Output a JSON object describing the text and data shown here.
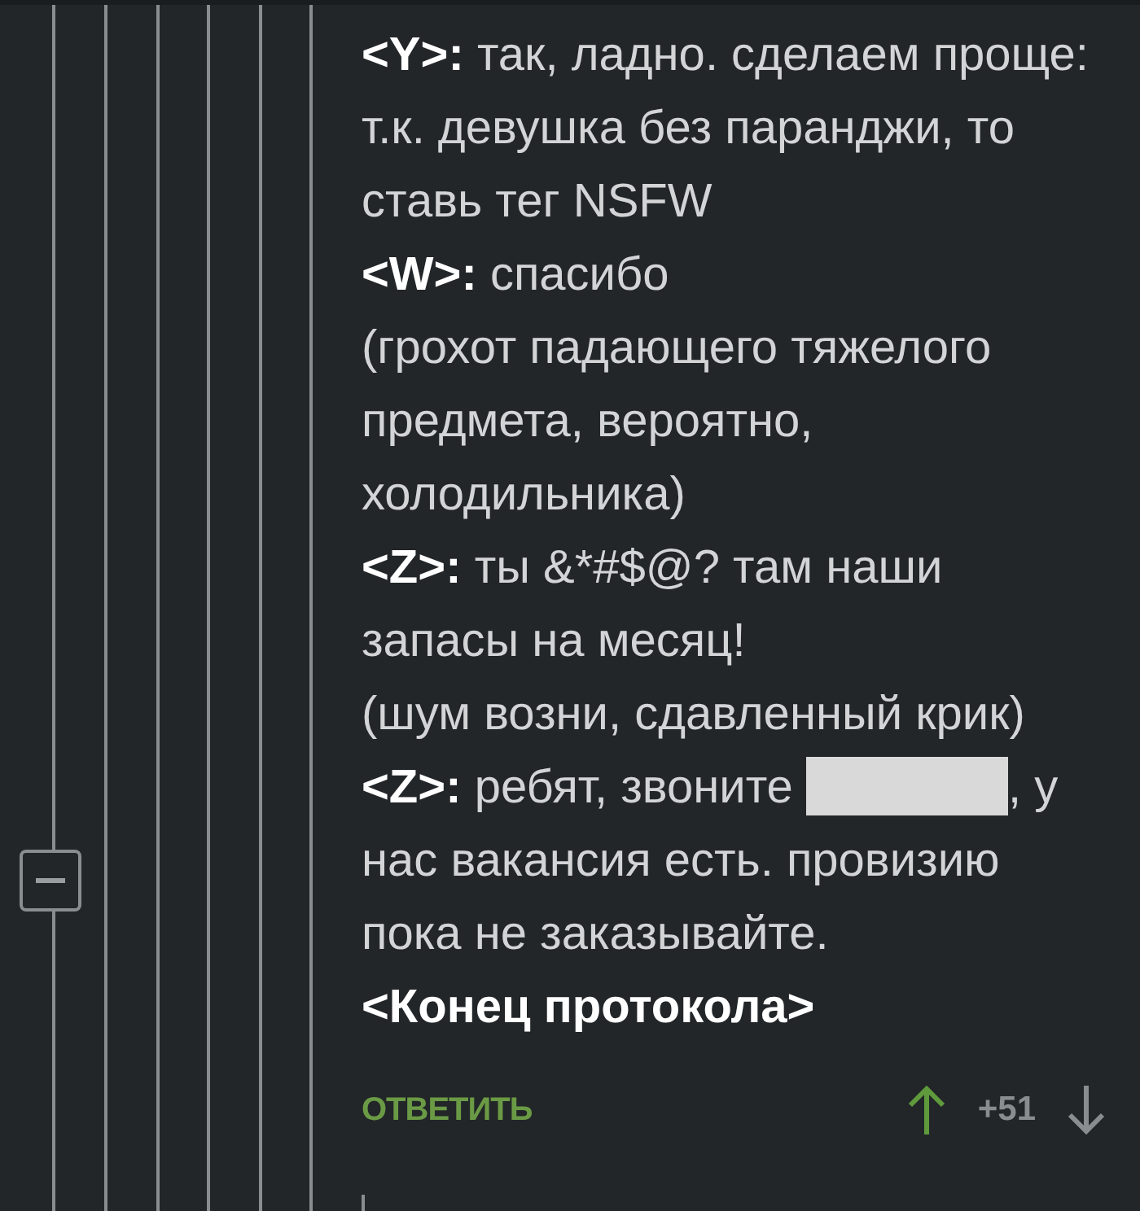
{
  "thread": {
    "expanded": true
  },
  "messages": [
    {
      "kind": "text",
      "speaker": "<Y>:",
      "text": "так, ладно. сделаем проще: т.к. девушка без паранджи, то ставь тег NSFW"
    },
    {
      "kind": "text",
      "speaker": "<W>:",
      "text": "спасибо"
    },
    {
      "kind": "text",
      "text": "(грохот падающего тяжелого предмета, вероятно, холодильника)"
    },
    {
      "kind": "text",
      "speaker": "<Z>:",
      "text": "ты &*#$@? там наши запасы на месяц!"
    },
    {
      "kind": "text",
      "text": "(шум возни, сдавленный крик)"
    },
    {
      "kind": "redacted",
      "speaker": "<Z>:",
      "before": "ребят, звоните",
      "after": ", у"
    },
    {
      "kind": "text",
      "text": "нас вакансия есть. провизию пока не заказывайте."
    },
    {
      "kind": "closing",
      "text": "<Конец протокола>"
    }
  ],
  "footer": {
    "reply": "ОТВЕТИТЬ",
    "score": "+51",
    "upvoted": true,
    "downvoted": false
  }
}
